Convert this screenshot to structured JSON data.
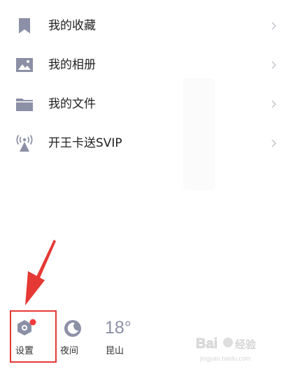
{
  "menu": {
    "items": [
      {
        "label": "我的收藏",
        "icon": "bookmark-icon"
      },
      {
        "label": "我的相册",
        "icon": "image-icon"
      },
      {
        "label": "我的文件",
        "icon": "folder-icon"
      },
      {
        "label": "开王卡送SVIP",
        "icon": "signal-tower-icon"
      }
    ]
  },
  "bottom": {
    "settings_label": "设置",
    "night_label": "夜间",
    "weather_temp": "18°",
    "weather_city": "昆山"
  },
  "colors": {
    "icon": "#8c90a6",
    "badge": "#f03c3c",
    "annotation": "#e53935"
  }
}
